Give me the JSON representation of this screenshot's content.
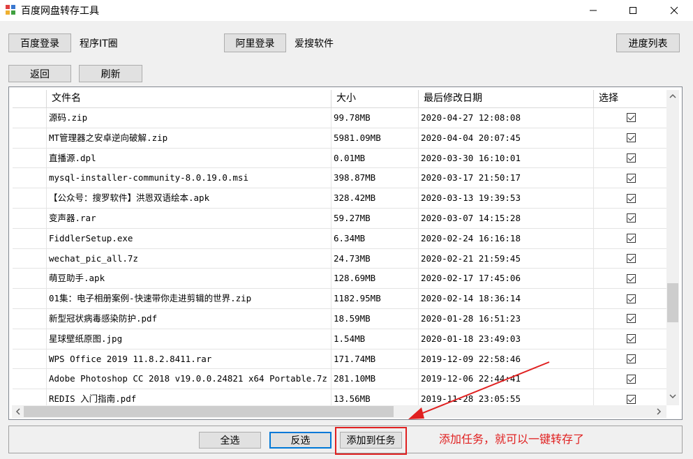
{
  "window": {
    "title": "百度网盘转存工具"
  },
  "toolbar": {
    "baidu_login": "百度登录",
    "baidu_user": "程序IT圈",
    "ali_login": "阿里登录",
    "ali_user": "爱搜软件",
    "progress_list": "进度列表",
    "back": "返回",
    "refresh": "刷新"
  },
  "grid": {
    "columns": [
      "文件名",
      "大小",
      "最后修改日期",
      "选择"
    ],
    "rows": [
      {
        "name": "源码.zip",
        "size": "99.78MB",
        "date": "2020-04-27 12:08:08",
        "checked": true
      },
      {
        "name": "MT管理器之安卓逆向破解.zip",
        "size": "5981.09MB",
        "date": "2020-04-04 20:07:45",
        "checked": true
      },
      {
        "name": "直播源.dpl",
        "size": "0.01MB",
        "date": "2020-03-30 16:10:01",
        "checked": true
      },
      {
        "name": "mysql-installer-community-8.0.19.0.msi",
        "size": "398.87MB",
        "date": "2020-03-17 21:50:17",
        "checked": true
      },
      {
        "name": "【公众号：搜罗软件】洪恩双语绘本.apk",
        "size": "328.42MB",
        "date": "2020-03-13 19:39:53",
        "checked": true
      },
      {
        "name": "变声器.rar",
        "size": "59.27MB",
        "date": "2020-03-07 14:15:28",
        "checked": true
      },
      {
        "name": "FiddlerSetup.exe",
        "size": "6.34MB",
        "date": "2020-02-24 16:16:18",
        "checked": true
      },
      {
        "name": "wechat_pic_all.7z",
        "size": "24.73MB",
        "date": "2020-02-21 21:59:45",
        "checked": true
      },
      {
        "name": "萌豆助手.apk",
        "size": "128.69MB",
        "date": "2020-02-17 17:45:06",
        "checked": true
      },
      {
        "name": "01集：电子相册案例-快速带你走进剪辑的世界.zip",
        "size": "1182.95MB",
        "date": "2020-02-14 18:36:14",
        "checked": true
      },
      {
        "name": "新型冠状病毒感染防护.pdf",
        "size": "18.59MB",
        "date": "2020-01-28 16:51:23",
        "checked": true
      },
      {
        "name": "星球壁纸原图.jpg",
        "size": "1.54MB",
        "date": "2020-01-18 23:49:03",
        "checked": true
      },
      {
        "name": "WPS Office 2019 11.8.2.8411.rar",
        "size": "171.74MB",
        "date": "2019-12-09 22:58:46",
        "checked": true
      },
      {
        "name": "Adobe Photoshop CC 2018 v19.0.0.24821 x64 Portable.7z",
        "size": "281.10MB",
        "date": "2019-12-06 22:44:41",
        "checked": true
      },
      {
        "name": "REDIS 入门指南.pdf",
        "size": "13.56MB",
        "date": "2019-11-28 23:05:55",
        "checked": true
      }
    ]
  },
  "bottom": {
    "select_all": "全选",
    "invert": "反选",
    "add_task": "添加到任务"
  },
  "annotation": {
    "text": "添加任务，就可以一键转存了",
    "color": "#e02020"
  },
  "icons": [
    "app-icon",
    "minimize-icon",
    "maximize-icon",
    "close-icon",
    "checkbox-checked-icon",
    "scroll-up-icon",
    "scroll-down-icon",
    "scroll-left-icon",
    "scroll-right-icon"
  ]
}
